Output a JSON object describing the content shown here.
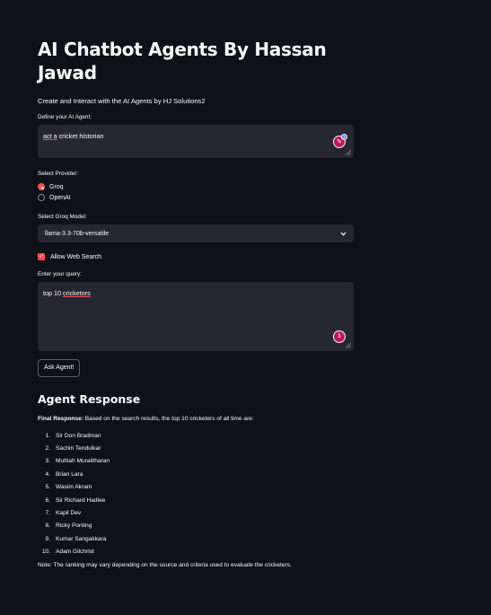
{
  "header": {
    "title_line1": "AI Chatbot Agents By Hassan",
    "title_line2": "Jawad",
    "subtitle": "Create and Interact with the AI Agents by HJ Solutions2"
  },
  "agent": {
    "label": "Define your AI Agent:",
    "value_prefix": "act",
    "value_a": " a",
    "value_rest": " cricket historian",
    "badge_count": "2"
  },
  "provider": {
    "label": "Select Provider:",
    "options": [
      "Groq",
      "OpenAI"
    ],
    "selected": "Groq"
  },
  "model": {
    "label": "Select Groq Model:",
    "value": "llama-3.3-70b-versatile"
  },
  "web_search": {
    "label": "Allow Web Search",
    "checked": true
  },
  "query": {
    "label": "Enter your query:",
    "value_prefix": "top 10 ",
    "value_word": "cricketors",
    "badge_count": "1"
  },
  "actions": {
    "ask_label": "Ask Agent!"
  },
  "response": {
    "header": "Agent Response",
    "final_label": "Final Response:",
    "final_text": " Based on the search results, the top 10 cricketers of all time are:",
    "items": [
      {
        "num": "1.",
        "name": "Sir Don Bradman"
      },
      {
        "num": "2.",
        "name": "Sachin Tendulkar"
      },
      {
        "num": "3.",
        "name": "Muttiah Muralitharan"
      },
      {
        "num": "4.",
        "name": "Brian Lara"
      },
      {
        "num": "5.",
        "name": "Wasim Akram"
      },
      {
        "num": "6.",
        "name": "Sir Richard Hadlee"
      },
      {
        "num": "7.",
        "name": "Kapil Dev"
      },
      {
        "num": "8.",
        "name": "Ricky Ponting"
      },
      {
        "num": "9.",
        "name": "Kumar Sangakkara"
      },
      {
        "num": "10.",
        "name": "Adam Gilchrist"
      }
    ],
    "note": "Note: The ranking may vary depending on the source and criteria used to evaluate the cricketers."
  },
  "colors": {
    "background": "#0e1117",
    "input_bg": "#262730",
    "accent": "#ff4b4b",
    "text": "#fafafa"
  },
  "icons": {
    "select_chevron": "chevron-down-icon",
    "checkbox": "check-icon",
    "grammar_badge": "grammarly-icon",
    "resize": "resize-handle-icon"
  }
}
